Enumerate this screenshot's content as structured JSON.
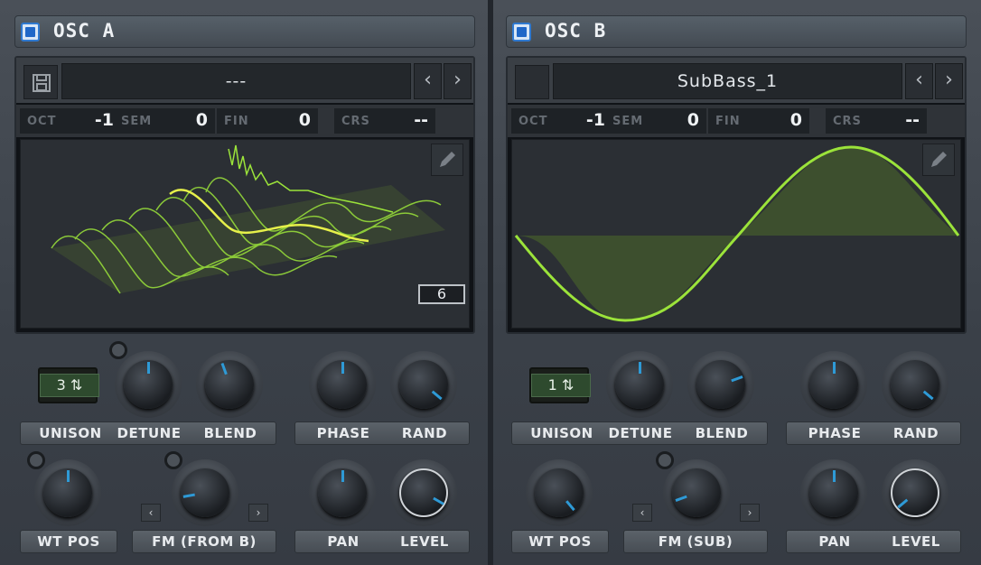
{
  "oscA": {
    "title": "OSC A",
    "preset": "---",
    "oct_label": "OCT",
    "oct": "-1",
    "sem_label": "SEM",
    "sem": "0",
    "fin_label": "FIN",
    "fin": "0",
    "crs_label": "CRS",
    "crs": "--",
    "frame_count": "6",
    "unison": "3",
    "labels": {
      "unison": "UNISON",
      "detune": "DETUNE",
      "blend": "BLEND",
      "phase": "PHASE",
      "rand": "RAND",
      "wtpos": "WT POS",
      "fm": "FM (FROM B)",
      "pan": "PAN",
      "level": "LEVEL"
    }
  },
  "oscB": {
    "title": "OSC B",
    "preset": "SubBass_1",
    "oct_label": "OCT",
    "oct": "-1",
    "sem_label": "SEM",
    "sem": "0",
    "fin_label": "FIN",
    "fin": "0",
    "crs_label": "CRS",
    "crs": "--",
    "unison": "1",
    "labels": {
      "unison": "UNISON",
      "detune": "DETUNE",
      "blend": "BLEND",
      "phase": "PHASE",
      "rand": "RAND",
      "wtpos": "WT POS",
      "fm": "FM (SUB)",
      "pan": "PAN",
      "level": "LEVEL"
    }
  },
  "icons": {
    "save": "save-icon",
    "prev": "chevron-left-icon",
    "next": "chevron-right-icon",
    "edit": "pencil-icon",
    "enable": "checkbox-icon"
  },
  "colors": {
    "accent": "#2e9ad6",
    "wave": "#9be33a",
    "wave_highlight": "#e6f04a",
    "enable": "#1f67c8"
  }
}
